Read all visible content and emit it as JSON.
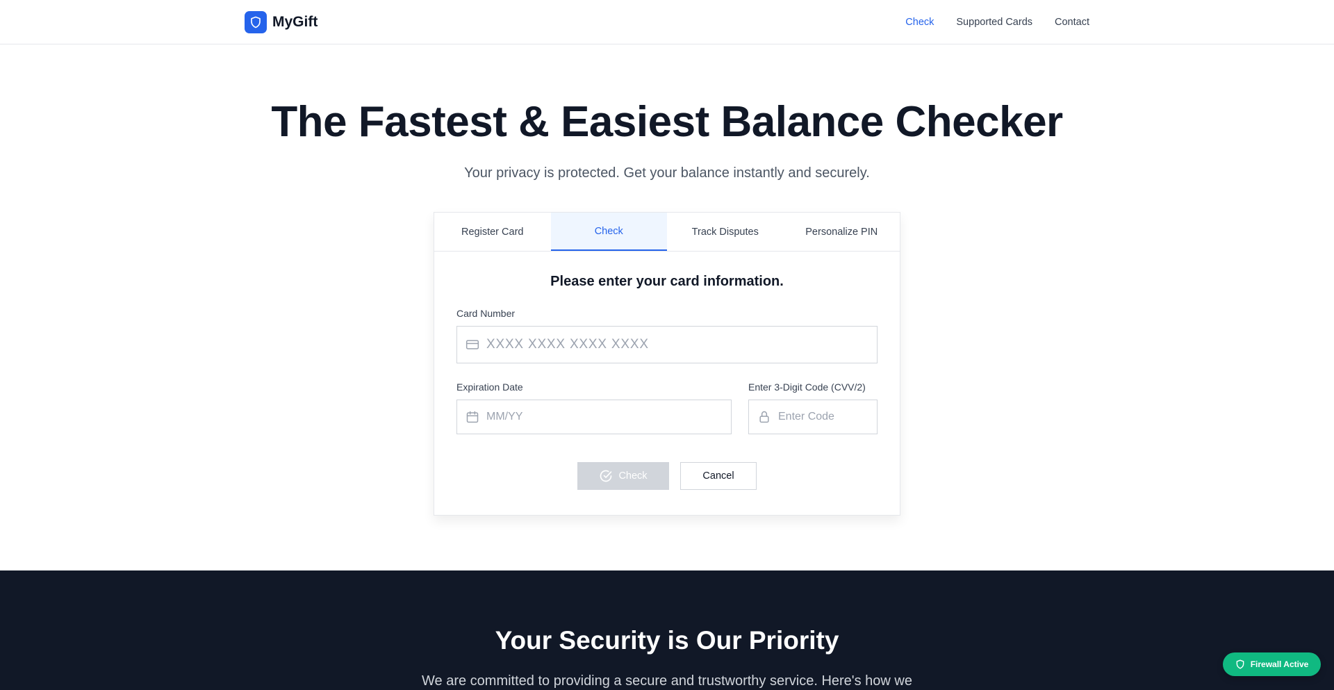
{
  "header": {
    "brand": "MyGift",
    "nav": [
      {
        "label": "Check",
        "active": true
      },
      {
        "label": "Supported Cards",
        "active": false
      },
      {
        "label": "Contact",
        "active": false
      }
    ]
  },
  "hero": {
    "title": "The Fastest & Easiest Balance Checker",
    "subtitle": "Your privacy is protected. Get your balance instantly and securely."
  },
  "form": {
    "tabs": [
      {
        "label": "Register Card",
        "active": false
      },
      {
        "label": "Check",
        "active": true
      },
      {
        "label": "Track Disputes",
        "active": false
      },
      {
        "label": "Personalize PIN",
        "active": false
      }
    ],
    "title": "Please enter your card information.",
    "card_number": {
      "label": "Card Number",
      "placeholder": "XXXX XXXX XXXX XXXX",
      "value": ""
    },
    "expiration": {
      "label": "Expiration Date",
      "placeholder": "MM/YY",
      "value": ""
    },
    "cvv": {
      "label": "Enter 3-Digit Code (CVV/2)",
      "placeholder": "Enter Code",
      "value": ""
    },
    "check_button": "Check",
    "cancel_button": "Cancel"
  },
  "security": {
    "title": "Your Security is Our Priority",
    "text": "We are committed to providing a secure and trustworthy service. Here's how we"
  },
  "badge": {
    "label": "Firewall Active"
  },
  "colors": {
    "accent": "#2563eb",
    "dark": "#111827",
    "success": "#10b981",
    "disabled": "#d1d5db"
  }
}
